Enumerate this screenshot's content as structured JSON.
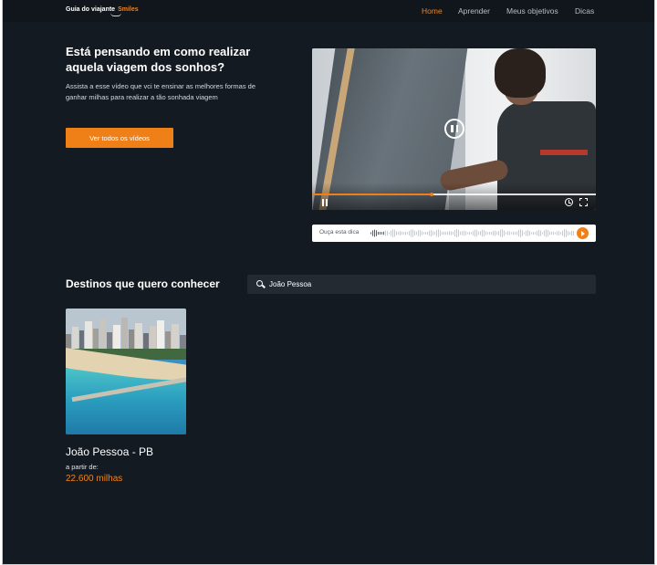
{
  "nav": {
    "brand": "Guia do viajante",
    "brand_accent": "Smiles",
    "links": [
      {
        "label": "Home",
        "active": true
      },
      {
        "label": "Aprender",
        "active": false
      },
      {
        "label": "Meus objetivos",
        "active": false
      },
      {
        "label": "Dicas",
        "active": false
      }
    ]
  },
  "hero": {
    "title": "Está pensando em como realizar aquela viagem dos sonhos?",
    "subtitle": "Assista a esse vídeo que vci te ensinar as melhores formas de ganhar milhas para realizar a tão sonhada viagem",
    "button_label": "Ver todos os vídeos"
  },
  "video": {
    "progress": 0.42,
    "state": "playing"
  },
  "audio": {
    "label": "Ouça esta dica"
  },
  "destinations": {
    "title": "Destinos que quero conhecer",
    "search": {
      "value": "João Pessoa",
      "placeholder": ""
    },
    "cards": [
      {
        "name": "João Pessoa - PB",
        "from_label": "a partir de:",
        "price": "22.600 milhas"
      }
    ]
  },
  "colors": {
    "accent": "#ef8018",
    "background": "#141a21",
    "nav_background": "#11161c",
    "search_background": "#232a32"
  },
  "icons": [
    "pause-icon",
    "clock-icon",
    "fullscreen-icon",
    "play-icon",
    "search-icon",
    "waveform-icon"
  ]
}
